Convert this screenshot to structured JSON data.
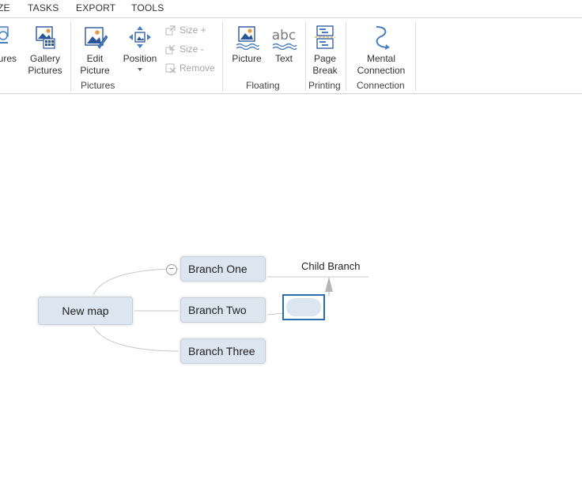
{
  "menu": {
    "items": [
      {
        "label": "ZE",
        "active": false
      },
      {
        "label": "TASKS",
        "active": false
      },
      {
        "label": "EXPORT",
        "active": false
      },
      {
        "label": "TOOLS",
        "active": false
      }
    ]
  },
  "ribbon": {
    "pictures_group": {
      "label": "Pictures",
      "partial_button": "ures",
      "gallery_pictures": {
        "line1": "Gallery",
        "line2": "Pictures",
        "icon": "gallery-pictures-icon"
      },
      "edit_picture": {
        "line1": "Edit",
        "line2": "Picture",
        "icon": "edit-picture-icon"
      },
      "position": {
        "label": "Position",
        "icon": "position-icon"
      },
      "size_plus": "Size +",
      "size_minus": "Size -",
      "remove": "Remove"
    },
    "floating_group": {
      "label": "Floating",
      "picture": {
        "label": "Picture",
        "icon": "floating-picture-icon"
      },
      "text": {
        "label": "Text",
        "icon": "floating-text-icon",
        "glyph": "abc"
      }
    },
    "printing_group": {
      "label": "Printing",
      "page_break": {
        "line1": "Page",
        "line2": "Break",
        "icon": "page-break-icon"
      }
    },
    "connection_group": {
      "label": "Connection",
      "mental_connection": {
        "line1": "Mental",
        "line2": "Connection",
        "icon": "mental-connection-icon"
      }
    }
  },
  "mindmap": {
    "central": "New map",
    "branches": [
      "Branch One",
      "Branch Two",
      "Branch Three"
    ],
    "child_branch": "Child Branch",
    "collapse_symbol": "−",
    "colors": {
      "node_fill": "#dce6f0",
      "node_border": "#c8cdd4",
      "selection": "#2b6cb0",
      "connector": "#c9c9c9"
    }
  }
}
